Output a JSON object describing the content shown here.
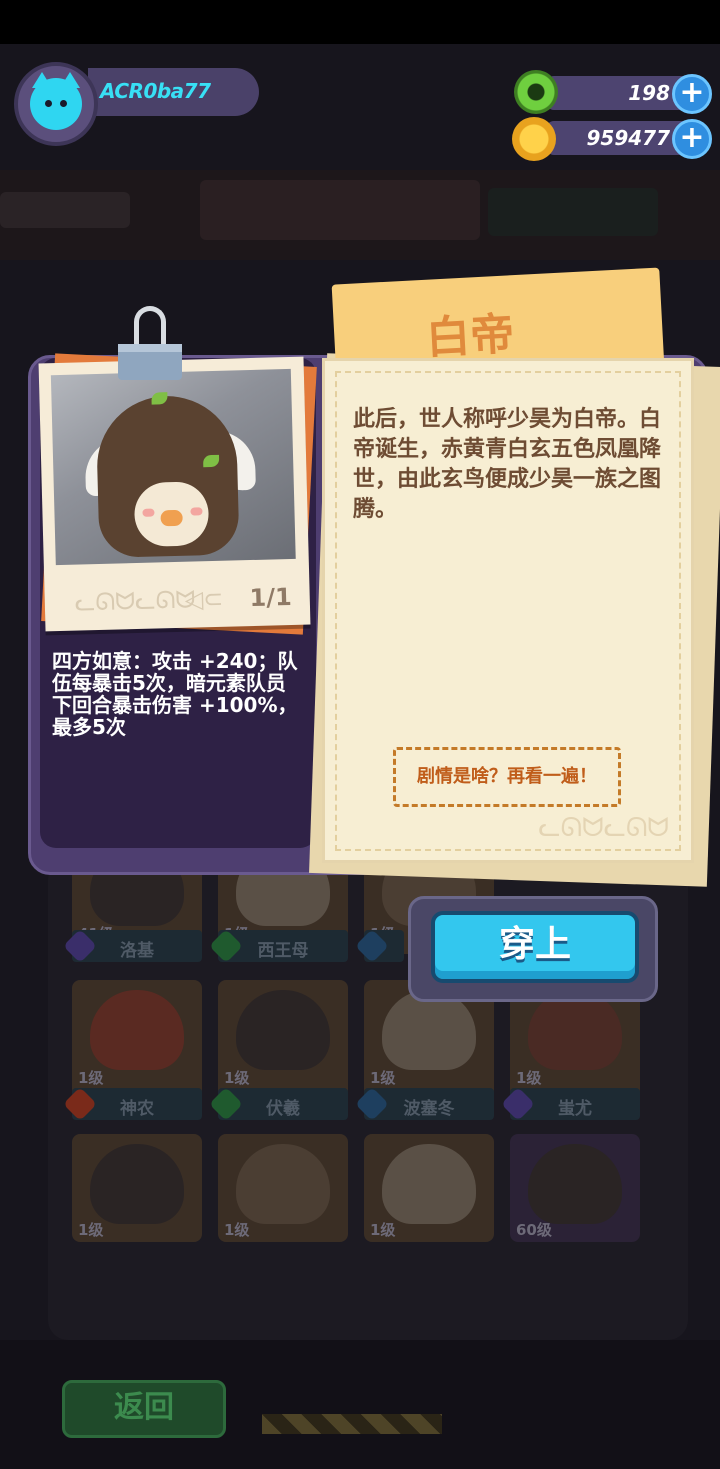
{
  "player": {
    "name": "ACR0ba77"
  },
  "resources": [
    {
      "name": "gem-donut",
      "value": "198",
      "color": "#5fbf3c"
    },
    {
      "name": "coin-planet",
      "value": "959477",
      "color": "#f5b82e"
    }
  ],
  "modal": {
    "title": "白帝",
    "photo_count": "1/1",
    "skill": "四方如意：攻击 +240；队伍每暴击5次，暗元素队员下回合暴击伤害 +100%，最多5次",
    "story": "此后，世人称呼少昊为白帝。白帝诞生，赤黄青白玄五色凤凰降世，由此玄鸟便成少昊一族之图腾。",
    "replay_label": "剧情是啥？再看一遍！",
    "equip_label": "穿上"
  },
  "characters": [
    {
      "level": "41级",
      "name": "洛基",
      "element_color": "#3a2e6a"
    },
    {
      "level": "1级",
      "name": "西王母",
      "element_color": "#1f5a2e"
    },
    {
      "level": "1级",
      "name": "",
      "element_color": "#1e3f5f"
    },
    {
      "level": "1级",
      "name": "神农",
      "element_color": "#7a2a1a"
    },
    {
      "level": "1级",
      "name": "伏羲",
      "element_color": "#1f5a2e"
    },
    {
      "level": "1级",
      "name": "波塞冬",
      "element_color": "#1e3f5f"
    },
    {
      "level": "1级",
      "name": "蚩尤",
      "element_color": "#3a2e6a"
    },
    {
      "level": "1级",
      "name": ""
    },
    {
      "level": "1级",
      "name": ""
    },
    {
      "level": "1级",
      "name": ""
    },
    {
      "level": "60级",
      "name": ""
    }
  ],
  "footer": {
    "back_label": "返回"
  },
  "colors": {
    "accent": "#33c7ee",
    "brand_purple": "#4e3e70",
    "paper": "#f7eed3",
    "title_orange": "#e08a3c"
  }
}
